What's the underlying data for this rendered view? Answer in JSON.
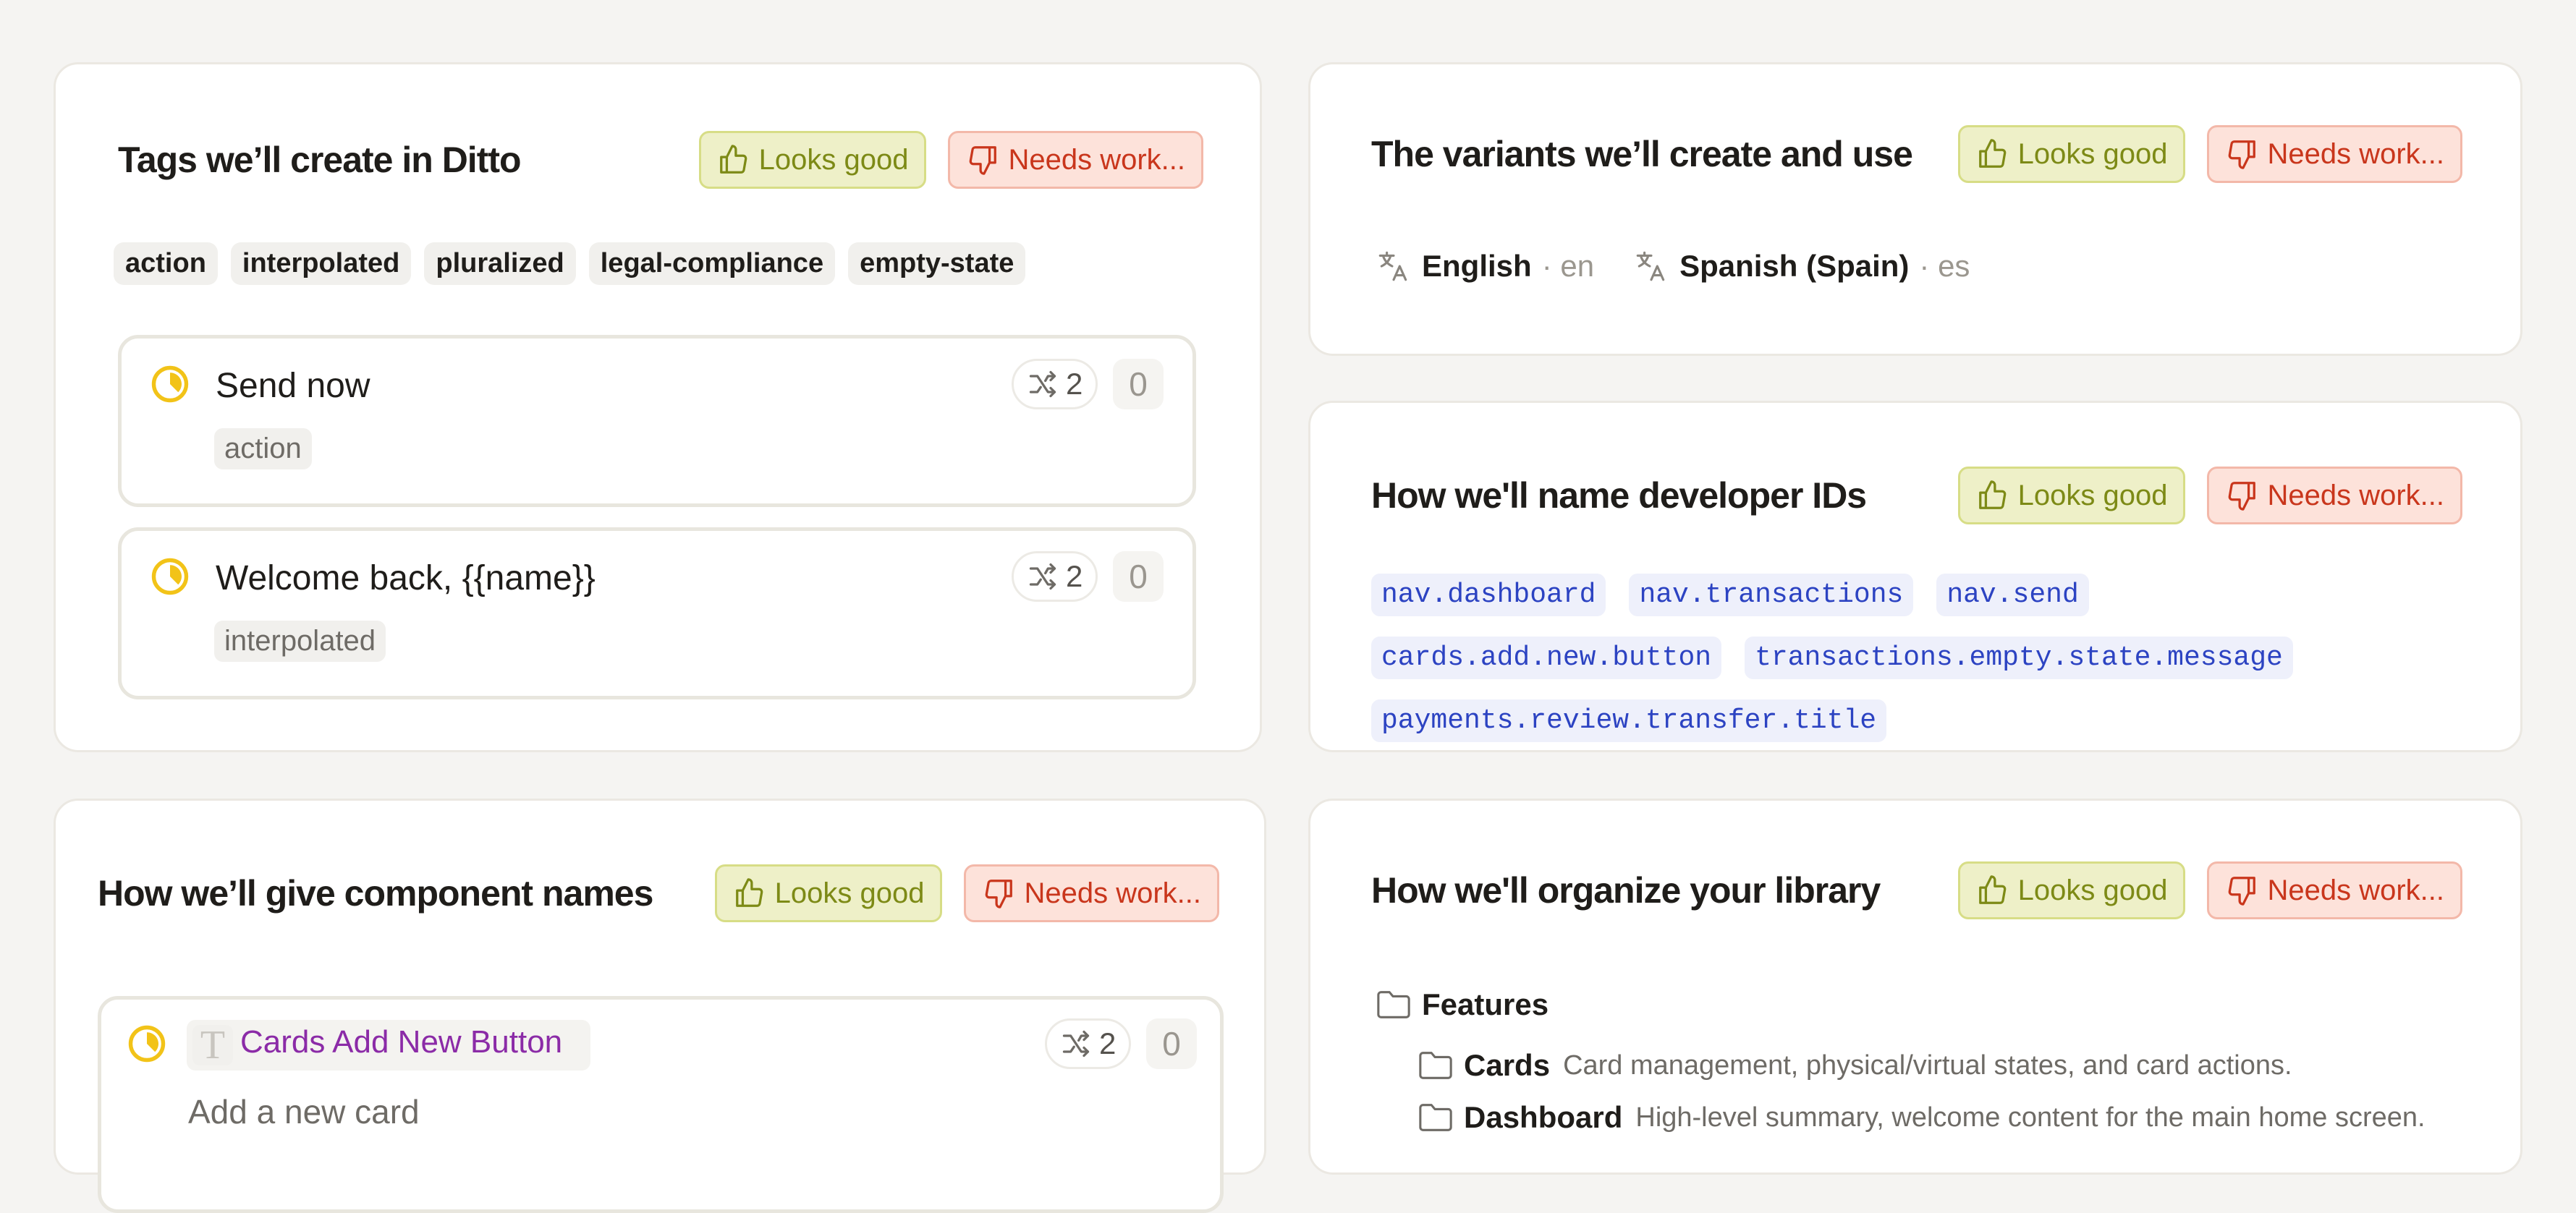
{
  "colors": {
    "page_bg": "#f5f4f2",
    "good_bg": "#eef0c8",
    "good_text": "#7d8a16",
    "bad_bg": "#fde2da",
    "bad_text": "#c9361c",
    "status_yellow": "#f2c318",
    "devid_text": "#2c43c2",
    "component_purple": "#8b2ba7"
  },
  "buttons": {
    "good_label": "Looks good",
    "bad_label": "Needs work...",
    "good_icon": "thumbs-up-icon",
    "bad_icon": "thumbs-down-icon"
  },
  "tags_card": {
    "title": "Tags we’ll create in Ditto",
    "tags": [
      "action",
      "interpolated",
      "pluralized",
      "legal-compliance",
      "empty-state"
    ],
    "items": [
      {
        "text": "Send now",
        "tag": "action",
        "variants": "2",
        "count": "0",
        "status_icon": "in-progress-icon"
      },
      {
        "text": "Welcome back, {{name}}",
        "tag": "interpolated",
        "variants": "2",
        "count": "0",
        "status_icon": "in-progress-icon"
      }
    ]
  },
  "variants_card": {
    "title": "The variants we’ll create and use",
    "variants": [
      {
        "name": "English",
        "code": "· en",
        "icon": "translate-icon"
      },
      {
        "name": "Spanish (Spain)",
        "code": "· es",
        "icon": "translate-icon"
      }
    ]
  },
  "dev_ids_card": {
    "title": "How we'll name developer IDs",
    "ids": [
      "nav.dashboard",
      "nav.transactions",
      "nav.send",
      "cards.add.new.button",
      "transactions.empty.state.message",
      "payments.review.transfer.title"
    ]
  },
  "components_card": {
    "title": "How we’ll give component names",
    "item": {
      "component_name": "Cards Add New Button",
      "text": "Add a new card",
      "variants": "2",
      "count": "0",
      "type_icon": "text-type-icon",
      "status_icon": "in-progress-icon"
    }
  },
  "library_card": {
    "title": "How we'll organize your library",
    "folders": [
      {
        "name": "Features",
        "description": "",
        "level": 0,
        "icon": "folder-icon"
      },
      {
        "name": "Cards",
        "description": "Card management, physical/virtual states, and card actions.",
        "level": 1,
        "icon": "folder-icon"
      },
      {
        "name": "Dashboard",
        "description": "High-level summary, welcome content for the main home screen.",
        "level": 1,
        "icon": "folder-icon"
      }
    ]
  }
}
